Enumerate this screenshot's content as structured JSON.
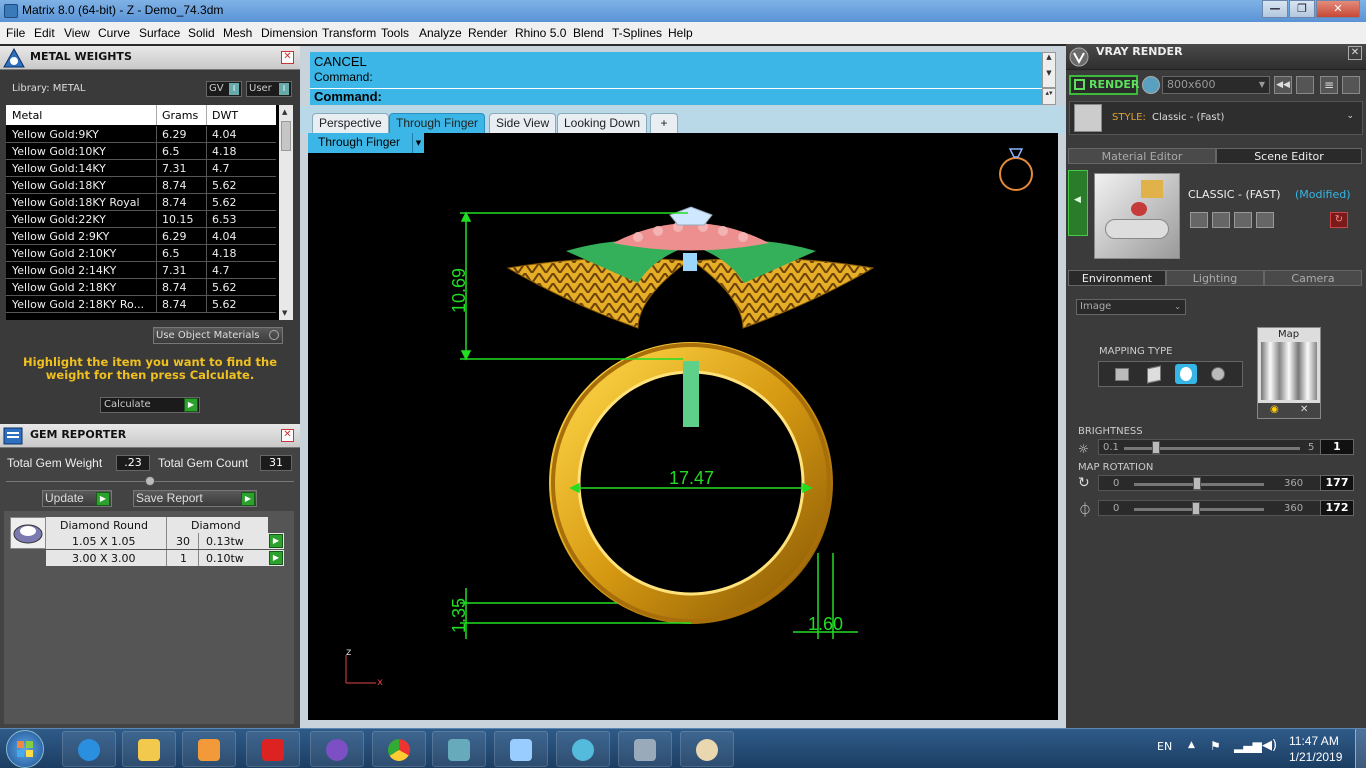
{
  "window": {
    "title": "Matrix 8.0 (64-bit) - Z - Demo_74.3dm",
    "min": "—",
    "max": "❐",
    "close": "✕"
  },
  "menu": [
    "File",
    "Edit",
    "View",
    "Curve",
    "Surface",
    "Solid",
    "Mesh",
    "Dimension",
    "Transform",
    "Tools",
    "Analyze",
    "Render",
    "Rhino 5.0",
    "Blend",
    "T-Splines",
    "Help"
  ],
  "metal": {
    "title": "METAL WEIGHTS",
    "library": "Library: METAL",
    "gv": "GV",
    "user": "User",
    "headers": [
      "Metal",
      "Grams",
      "DWT"
    ],
    "rows": [
      [
        "Yellow Gold:9KY",
        "6.29",
        "4.04"
      ],
      [
        "Yellow Gold:10KY",
        "6.5",
        "4.18"
      ],
      [
        "Yellow Gold:14KY",
        "7.31",
        "4.7"
      ],
      [
        "Yellow Gold:18KY",
        "8.74",
        "5.62"
      ],
      [
        "Yellow Gold:18KY Royal",
        "8.74",
        "5.62"
      ],
      [
        "Yellow Gold:22KY",
        "10.15",
        "6.53"
      ],
      [
        "Yellow Gold 2:9KY",
        "6.29",
        "4.04"
      ],
      [
        "Yellow Gold 2:10KY",
        "6.5",
        "4.18"
      ],
      [
        "Yellow Gold 2:14KY",
        "7.31",
        "4.7"
      ],
      [
        "Yellow Gold 2:18KY",
        "8.74",
        "5.62"
      ],
      [
        "Yellow Gold 2:18KY Ro...",
        "8.74",
        "5.62"
      ]
    ],
    "use_object_materials": "Use Object Materials",
    "hint": "Highlight the item you want to find the weight for then press Calculate.",
    "calculate": "Calculate"
  },
  "gem": {
    "title": "GEM REPORTER",
    "weight_label": "Total Gem Weight",
    "weight_value": ".23",
    "count_label": "Total Gem Count",
    "count_value": "31",
    "update": "Update",
    "save": "Save Report",
    "headers": [
      "Diamond Round",
      "Diamond"
    ],
    "rows": [
      [
        "1.05 X 1.05",
        "30",
        "0.13tw"
      ],
      [
        "3.00 X 3.00",
        "1",
        "0.10tw"
      ]
    ]
  },
  "command": {
    "line1": "CANCEL",
    "line2": "Command:",
    "prompt": "Command:"
  },
  "viewport": {
    "tabs": [
      "Perspective",
      "Through Finger",
      "Side View",
      "Looking Down",
      "+"
    ],
    "active_tab": "Through Finger",
    "view_label": "Through Finger",
    "dims": {
      "top_height": "10.69",
      "inner_width": "17.47",
      "bottom": "1.35",
      "side": "1.60"
    },
    "axis_z": "z",
    "axis_x": "x"
  },
  "vray": {
    "title": "VRAY RENDER",
    "render": "RENDER",
    "resolution": "800x600",
    "style_label": "STYLE:",
    "style_value": "Classic - (Fast)",
    "tabs": [
      "Material Editor",
      "Scene Editor"
    ],
    "scene_name": "CLASSIC - (FAST)",
    "scene_status": "(Modified)",
    "env_tabs": [
      "Environment",
      "Lighting",
      "Camera"
    ],
    "image_select": "Image",
    "mapping_type": "MAPPING TYPE",
    "map_label": "Map",
    "brightness_label": "BRIGHTNESS",
    "brightness_min": "0.1",
    "brightness_max": "5",
    "brightness_value": "1",
    "rotation_label": "MAP ROTATION",
    "rot1_min": "0",
    "rot1_max": "360",
    "rot1_value": "177",
    "rot2_min": "0",
    "rot2_max": "360",
    "rot2_value": "172"
  },
  "taskbar": {
    "lang": "EN",
    "time": "11:47 AM",
    "date": "1/21/2019"
  }
}
